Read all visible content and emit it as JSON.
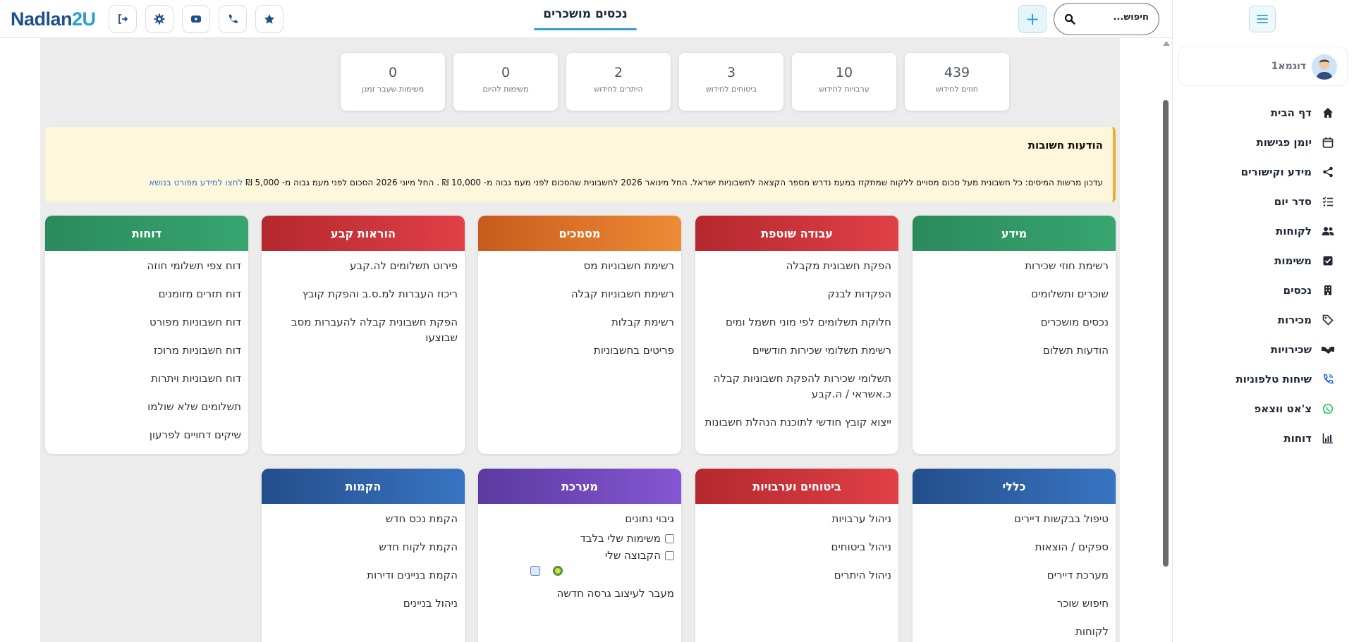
{
  "header": {
    "logo_main": "Nadlan",
    "logo_accent": "2U",
    "page_title": "נכסים מושכרים",
    "search_placeholder": "חיפוש..."
  },
  "sidebar": {
    "user_name": "דוגמא1",
    "items": [
      {
        "label": "דף הבית",
        "icon": "home-icon"
      },
      {
        "label": "יומן פגישות",
        "icon": "calendar-icon"
      },
      {
        "label": "מידע וקישורים",
        "icon": "share-icon"
      },
      {
        "label": "סדר יום",
        "icon": "checklist-icon"
      },
      {
        "label": "לקוחות",
        "icon": "users-icon"
      },
      {
        "label": "משימות",
        "icon": "task-check-icon"
      },
      {
        "label": "נכסים",
        "icon": "building-icon"
      },
      {
        "label": "מכירות",
        "icon": "tag-icon"
      },
      {
        "label": "שכירויות",
        "icon": "handshake-icon"
      },
      {
        "label": "שיחות טלפוניות",
        "icon": "phone-call-icon"
      },
      {
        "label": "צ'אט ווצאפ",
        "icon": "whatsapp-icon"
      },
      {
        "label": "דוחות",
        "icon": "bar-chart-icon"
      }
    ]
  },
  "stats": [
    {
      "value": "439",
      "label": "חוזים לחידוש"
    },
    {
      "value": "10",
      "label": "ערבויות לחידוש"
    },
    {
      "value": "3",
      "label": "ביטוחים לחידוש"
    },
    {
      "value": "2",
      "label": "היתרים לחידוש"
    },
    {
      "value": "0",
      "label": "משימות להיום"
    },
    {
      "value": "0",
      "label": "משימות שעבר זמנן"
    }
  ],
  "notice": {
    "title": "הודעות חשובות",
    "text": "עדכון מרשות המיסים: כל חשבונית מעל סכום מסויים ללקוח שמתקזז במעמ נדרש מספר הקצאה לחשבוניות ישראל. החל מינואר 2026 לחשבונית שהסכום לפני מעמ גבוה מ- 10,000 ₪ . החל מיוני 2026 הסכום לפני מעמ גבוה מ- 5,000 ₪",
    "link": "לחצו למידע מפורט בנושא"
  },
  "cards": {
    "info": {
      "title": "מידע",
      "items": [
        "רשימת חוזי שכירות",
        "שוכרים ותשלומים",
        "נכסים מושכרים",
        "הודעות תשלום"
      ]
    },
    "work": {
      "title": "עבודה שוטפת",
      "items": [
        "הפקת חשבונית מקבלה",
        "הפקדות לבנק",
        "חלוקת תשלומים לפי מוני חשמל ומים",
        "רשימת תשלומי שכירות חודשיים",
        "תשלומי שכירות להפקת חשבוניות קבלה כ.אשראי / ה.קבע",
        "ייצוא קובץ חודשי לתוכנת הנהלת חשבונות"
      ]
    },
    "docs": {
      "title": "מסמכים",
      "items": [
        "רשימת חשבוניות מס",
        "רשימת חשבוניות קבלה",
        "רשימת קבלות",
        "פריטים בחשבוניות"
      ]
    },
    "standing": {
      "title": "הוראות קבע",
      "items": [
        "פירוט תשלומים לה.קבע",
        "ריכוז העברות למ.ס.ב והפקת קובץ",
        "הפקת חשבונית קבלה להעברות מסב שבוצעו"
      ]
    },
    "reports": {
      "title": "דוחות",
      "items": [
        "דוח צפי תשלומי חוזה",
        "דוח תזרים מזומנים",
        "דוח חשבוניות מפורט",
        "דוח חשבוניות מרוכז",
        "דוח חשבוניות ויתרות",
        "תשלומים שלא שולמו",
        "שיקים דחויים לפרעון"
      ]
    },
    "general": {
      "title": "כללי",
      "items": [
        "טיפול בבקשות דיירים",
        "ספקים / הוצאות",
        "מערכת דיירים",
        "חיפוש שוכר",
        "לקוחות"
      ]
    },
    "insurance": {
      "title": "ביטוחים וערבויות",
      "items": [
        "ניהול ערבויות",
        "ניהול ביטוחים",
        "ניהול היתרים"
      ]
    },
    "system": {
      "title": "מערכת",
      "items": [
        "גיבוי נתונים"
      ],
      "checkbox_mine": "משימות שלי בלבד",
      "checkbox_group": "הקבוצה שלי",
      "last_item": "מעבר לעיצוב גרסה חדשה"
    },
    "setup": {
      "title": "הקמות",
      "items": [
        "הקמת נכס חדש",
        "הקמת לקוח חדש",
        "הקמת בניינים ודירות",
        "ניהול בניינים"
      ]
    }
  }
}
